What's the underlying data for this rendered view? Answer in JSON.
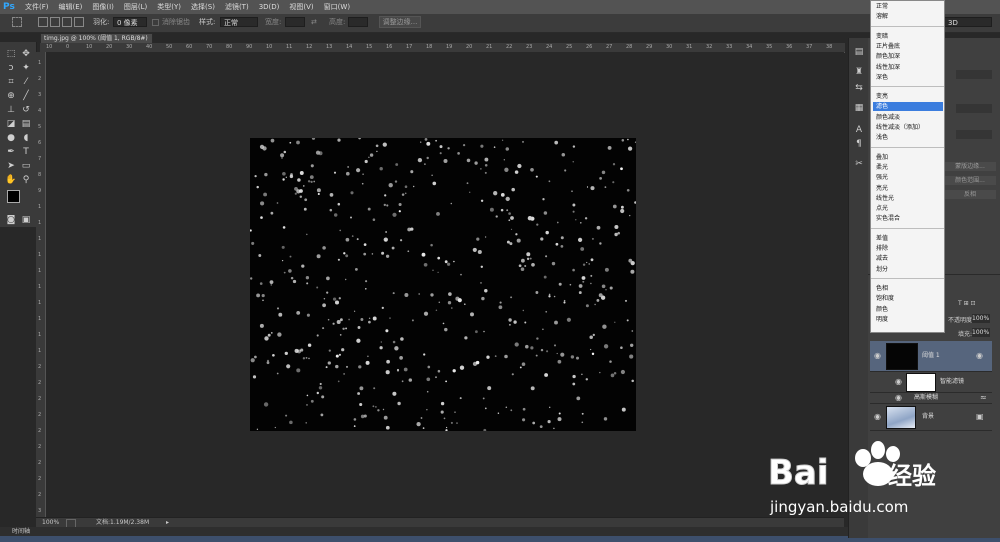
{
  "app": {
    "logo": "Ps"
  },
  "menu": [
    "文件(F)",
    "编辑(E)",
    "图像(I)",
    "图层(L)",
    "类型(Y)",
    "选择(S)",
    "滤镜(T)",
    "3D(D)",
    "视图(V)",
    "窗口(W)"
  ],
  "options_bar": {
    "feather_label": "羽化:",
    "feather_value": "0 像素",
    "antialias_label": "消除锯齿",
    "style_label": "样式:",
    "style_value": "正常",
    "width_label": "宽度:",
    "height_label": "高度:",
    "refine_edge_button": "调整边缘...",
    "workspace_value": "3D"
  },
  "document": {
    "tab_title": "timg.jpg @ 100% (阈值 1, RGB/8#) *",
    "ruler_top": [
      "10",
      "0",
      "10",
      "20",
      "30",
      "40",
      "50",
      "60",
      "70",
      "80",
      "90",
      "10",
      "11",
      "12",
      "13",
      "14",
      "15",
      "16",
      "17",
      "18",
      "19",
      "20",
      "21",
      "22",
      "23",
      "24",
      "25",
      "26",
      "27",
      "28",
      "29",
      "30",
      "31",
      "32",
      "33",
      "34",
      "35",
      "36",
      "37",
      "38"
    ],
    "ruler_left": [
      "1",
      "2",
      "3",
      "4",
      "5",
      "6",
      "7",
      "8",
      "9",
      "1",
      "1",
      "1",
      "1",
      "1",
      "1",
      "1",
      "1",
      "1",
      "1",
      "2",
      "2",
      "2",
      "2",
      "2",
      "2",
      "2",
      "2",
      "2",
      "3"
    ]
  },
  "status": {
    "zoom": "100%",
    "doc_info": "文档:1.19M/2.38M"
  },
  "timeline_label": "时间轴",
  "blend_modes": {
    "groups": [
      [
        "正常",
        "溶解"
      ],
      [
        "变暗",
        "正片叠底",
        "颜色加深",
        "线性加深",
        "深色"
      ],
      [
        "变亮",
        "滤色",
        "颜色减淡",
        "线性减淡（添加）",
        "浅色"
      ],
      [
        "叠加",
        "柔光",
        "强光",
        "亮光",
        "线性光",
        "点光",
        "实色混合"
      ],
      [
        "差值",
        "排除",
        "减去",
        "划分"
      ],
      [
        "色相",
        "饱和度",
        "颜色",
        "明度"
      ]
    ],
    "selected": "滤色"
  },
  "panels": {
    "opacity_label": "不透明度:",
    "opacity_value": "100%",
    "fill_label": "填充:",
    "fill_value": "100%",
    "panel_buttons": [
      "蒙版边缘...",
      "颜色范围...",
      "反相"
    ],
    "workspace_field": "3D"
  },
  "layers": [
    {
      "name": "阈值 1",
      "selected": true
    },
    {
      "name": "智能滤镜",
      "selected": false
    },
    {
      "name": "高斯模糊",
      "selected": false
    },
    {
      "name": "背景",
      "selected": false
    }
  ],
  "watermark": {
    "brand": "Bai",
    "brand_cn": "经验",
    "url": "jingyan.baidu.com"
  },
  "colors": {
    "selection": "#3b7dde",
    "ps_blue": "#31a8ff",
    "watermark_blue": "#2a5fd8"
  }
}
